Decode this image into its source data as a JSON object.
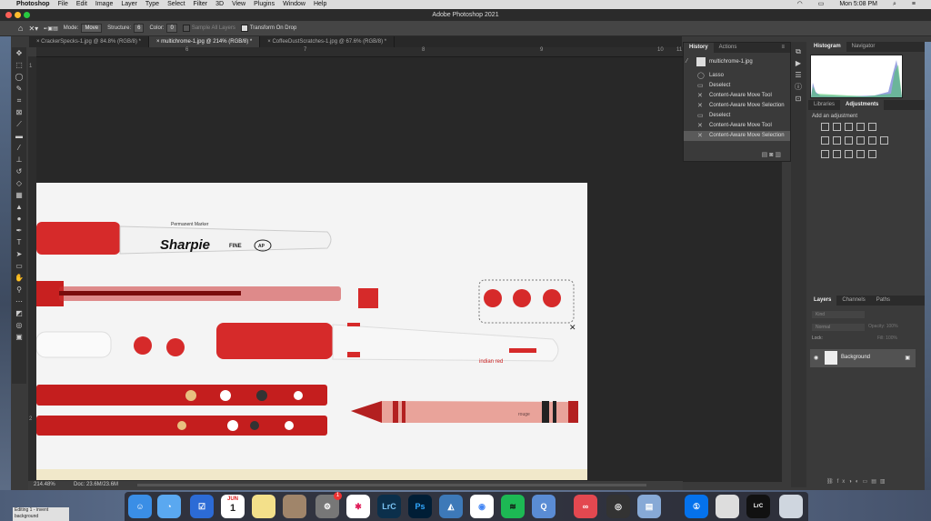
{
  "menubar": {
    "app_name": "Photoshop",
    "items": [
      "File",
      "Edit",
      "Image",
      "Layer",
      "Type",
      "Select",
      "Filter",
      "3D",
      "View",
      "Plugins",
      "Window",
      "Help"
    ],
    "clock": "Mon 5:08 PM"
  },
  "window": {
    "title": "Adobe Photoshop 2021"
  },
  "options": {
    "mode_label": "Mode:",
    "mode_value": "Move",
    "structure_label": "Structure:",
    "structure_value": "6",
    "color_label": "Color:",
    "color_value": "0",
    "sample_label": "Sample All Layers",
    "transform_label": "Transform On Drop"
  },
  "tabs": [
    {
      "label": "CrackerSpecks-1.jpg @ 84.8% (RGB/8) *"
    },
    {
      "label": "multichrome-1.jpg @ 214% (RGB/8) *"
    },
    {
      "label": "CoffeeDustScratches-1.jpg @ 67.6% (RGB/8) *"
    }
  ],
  "ruler": {
    "top": [
      "6",
      "7",
      "8",
      "9",
      "10",
      "11"
    ],
    "left": [
      "1",
      "2"
    ]
  },
  "status": {
    "zoom": "214.48%",
    "doc": "Doc: 23.6M/23.6M"
  },
  "history": {
    "tabs": [
      "History",
      "Actions"
    ],
    "snapshot": "multichrome-1.jpg",
    "items": [
      "Lasso",
      "Deselect",
      "Content-Aware Move Tool",
      "Content-Aware Move Selection",
      "Deselect",
      "Content-Aware Move Tool",
      "Content-Aware Move Selection"
    ]
  },
  "right_panels": {
    "top_tabs": [
      "Histogram",
      "Navigator"
    ],
    "mid_tabs": [
      "Libraries",
      "Adjustments"
    ],
    "add_adjustment": "Add an adjustment",
    "layer_tabs": [
      "Layers",
      "Channels",
      "Paths"
    ],
    "kind_label": "Kind",
    "blend_mode": "Normal",
    "opacity_label": "Opacity:",
    "opacity_value": "100%",
    "lock_label": "Lock:",
    "fill_label": "Fill:",
    "fill_value": "100%",
    "layer_name": "Background"
  },
  "artwork": {
    "marker_brand": "Sharpie",
    "marker_sub": "Permanent Marker",
    "marker_fine": "FINE",
    "marker_ap": "AP",
    "indian_red": "indian red",
    "crayon_word": "rouge"
  },
  "dock": {
    "calendar_month": "JUN",
    "calendar_day": "1",
    "badge": "1",
    "lrc": "LrC",
    "ps": "Ps",
    "lrc_small": "LrC"
  },
  "tooltip": {
    "line1": "Editing 1 - invent",
    "line2": "background"
  },
  "colors": {
    "accent_red": "#d62a2a",
    "panel_bg": "#3a3a3a",
    "selected_row": "#5a5a5a"
  }
}
